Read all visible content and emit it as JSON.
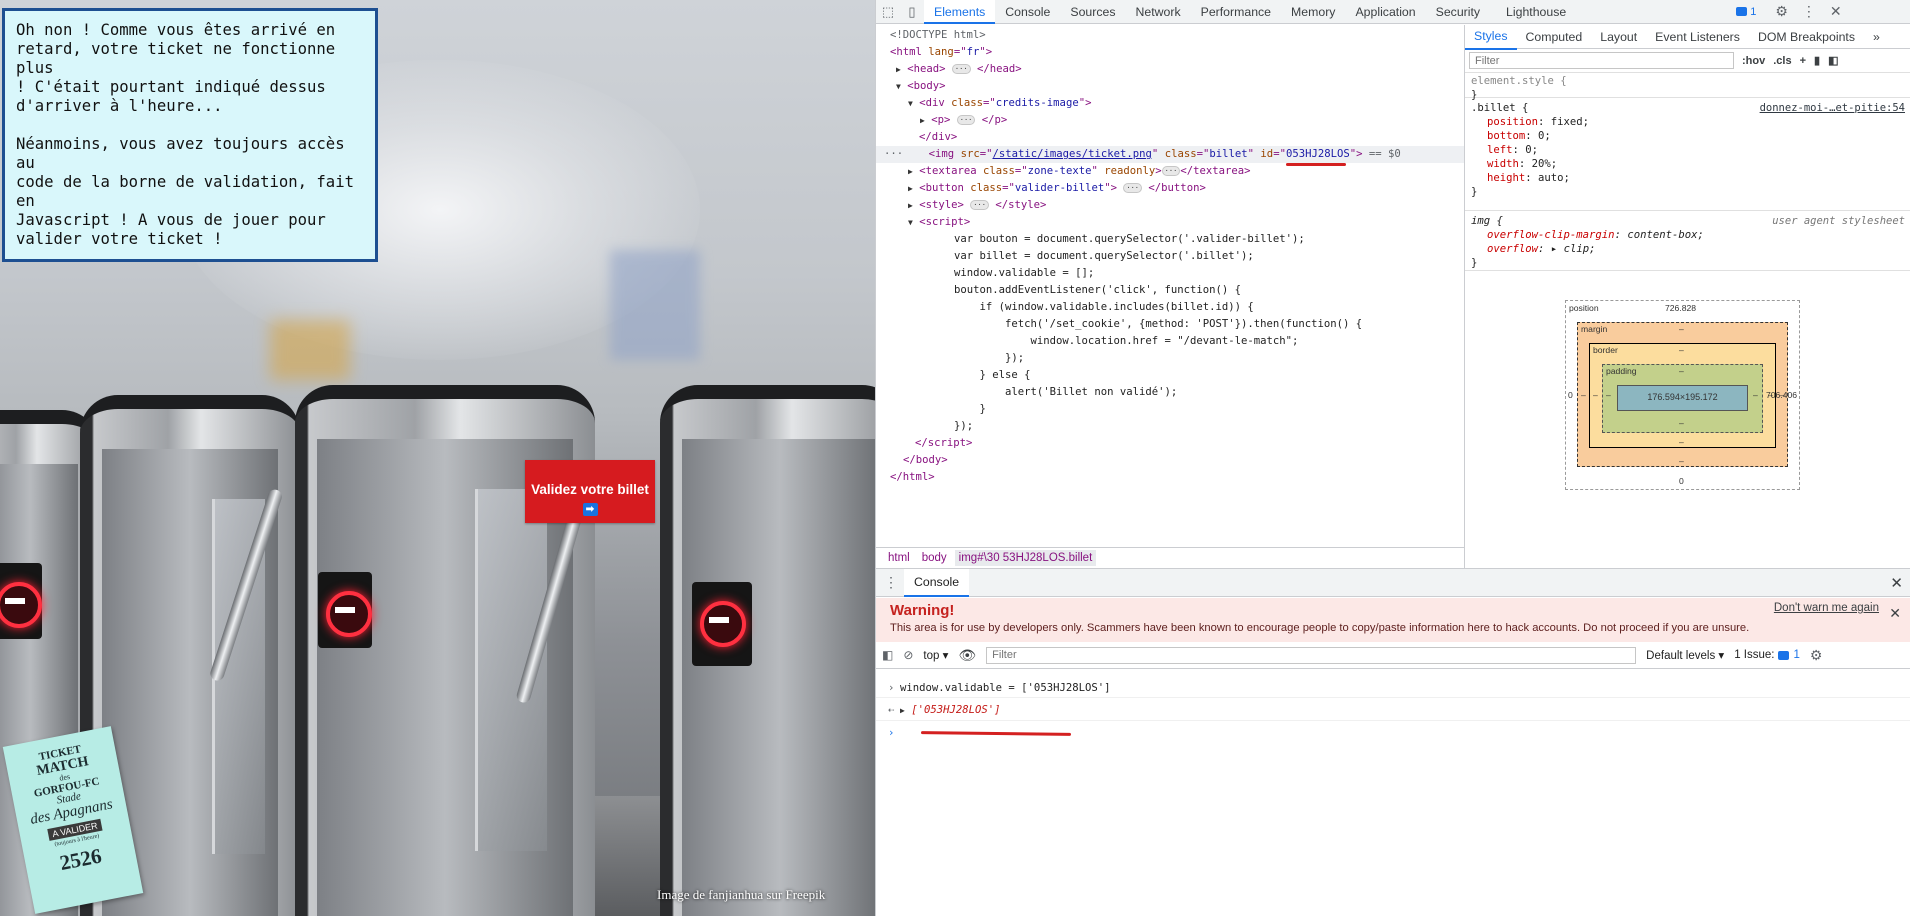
{
  "page": {
    "info_text": "Oh non ! Comme vous êtes arrivé en\nretard, votre ticket ne fonctionne plus\n! C'était pourtant indiqué dessus\nd'arriver à l'heure...\n\nNéanmoins, vous avez toujours accès au\ncode de la borne de validation, fait en\nJavascript ! A vous de jouer pour\nvalider votre ticket !",
    "validate_button": "Validez votre billet",
    "credit": "Image de fanjianhua sur Freepik",
    "ticket": {
      "line1": "TICKET",
      "line2": "MATCH",
      "line3": "des",
      "line4": "GORFOU-FC",
      "line5": "Stade",
      "line6": "des Apagnans",
      "stamp": "A VALIDER",
      "line7": "(toujours à l'heure)",
      "number": "2526"
    }
  },
  "devtools": {
    "tabs": [
      "Elements",
      "Console",
      "Sources",
      "Network",
      "Performance",
      "Memory",
      "Application",
      "Security",
      "Lighthouse"
    ],
    "active_tab": "Elements",
    "issues_count": "1",
    "elements": {
      "doctype": "<!DOCTYPE html>",
      "lines": [
        "html lang=\"fr\"",
        "head",
        "body",
        "div class=\"credits-image\"",
        "p",
        "/div"
      ],
      "selected_src": "/static/images/ticket.png",
      "selected_class": "billet",
      "selected_id": "053HJ28LOS",
      "selected_suffix": "== $0",
      "textarea_class": "zone-texte",
      "button_class": "valider-billet",
      "script": [
        "var bouton = document.querySelector('.valider-billet');",
        "var billet = document.querySelector('.billet');",
        "window.validable = [];",
        "bouton.addEventListener('click', function() {",
        "    if (window.validable.includes(billet.id)) {",
        "        fetch('/set_cookie', {method: 'POST'}).then(function() {",
        "            window.location.href = \"/devant-le-match\";",
        "        });",
        "    } else {",
        "        alert('Billet non validé');",
        "    }",
        "});"
      ],
      "breadcrumbs": [
        "html",
        "body",
        "img#\\30 53HJ28LOS.billet"
      ]
    },
    "styles": {
      "tabs": [
        "Styles",
        "Computed",
        "Layout",
        "Event Listeners",
        "DOM Breakpoints"
      ],
      "active_tab": "Styles",
      "filter_placeholder": "Filter",
      "hov": ":hov",
      "cls": ".cls",
      "element_style": "element.style {",
      "billet_selector": ".billet {",
      "billet_source": "donnez-moi-…et-pitie:54",
      "billet_props": [
        {
          "name": "position",
          "value": "fixed;"
        },
        {
          "name": "bottom",
          "value": "0;"
        },
        {
          "name": "left",
          "value": "0;"
        },
        {
          "name": "width",
          "value": "20%;"
        },
        {
          "name": "height",
          "value": "auto;"
        }
      ],
      "img_selector": "img {",
      "img_source": "user agent stylesheet",
      "img_props": [
        {
          "name": "overflow-clip-margin",
          "value": "content-box;"
        },
        {
          "name": "overflow",
          "value": "clip;"
        }
      ],
      "box_model": {
        "position_label": "position",
        "position_top": "726.828",
        "position_left": "0",
        "position_right": "706.406",
        "position_bottom": "0",
        "margin_label": "margin",
        "border_label": "border",
        "padding_label": "padding",
        "content": "176.594×195.172",
        "dash": "–"
      }
    },
    "console": {
      "tab": "Console",
      "warning_title": "Warning!",
      "warning_text": "This area is for use by developers only. Scammers have been known to encourage people to copy/paste information here to hack accounts. Do not proceed if you are unsure.",
      "dont_warn": "Don't warn me again",
      "context": "top",
      "filter_placeholder": "Filter",
      "levels": "Default levels",
      "issues": "1 Issue:",
      "issues_count": "1",
      "input_line": "window.validable = ['053HJ28LOS']",
      "output_line": "['053HJ28LOS']"
    }
  }
}
